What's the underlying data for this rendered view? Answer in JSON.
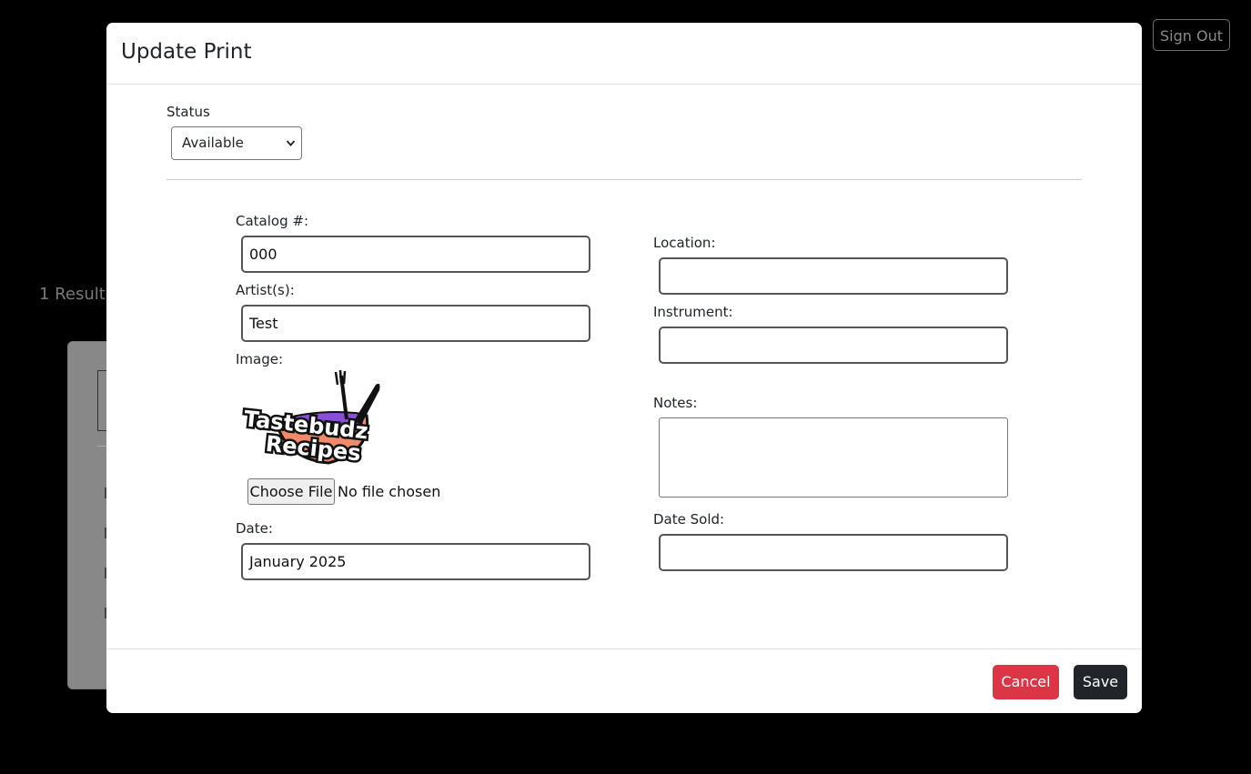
{
  "background": {
    "signout_label": "Sign Out",
    "results_label": "1 Result("
  },
  "modal": {
    "title": "Update Print",
    "status": {
      "label": "Status",
      "value": "Available"
    },
    "fields": {
      "catalog": {
        "label": "Catalog #:",
        "value": "000"
      },
      "artists": {
        "label": "Artist(s):",
        "value": "Test"
      },
      "image": {
        "label": "Image:",
        "logo_line1": "Tastebudz",
        "logo_line2": "Recipes",
        "file_button": "Choose File",
        "file_status": "No file chosen"
      },
      "date": {
        "label": "Date:",
        "value": "January 2025"
      },
      "location": {
        "label": "Location:",
        "value": ""
      },
      "instrument": {
        "label": "Instrument:",
        "value": ""
      },
      "notes": {
        "label": "Notes:",
        "value": ""
      },
      "date_sold": {
        "label": "Date Sold:",
        "value": ""
      }
    },
    "footer": {
      "cancel_label": "Cancel",
      "save_label": "Save"
    }
  },
  "colors": {
    "cancel": "#dc3545",
    "save": "#212529",
    "logo_purple": "#8a4fd8",
    "logo_orange": "#f08a6a"
  }
}
